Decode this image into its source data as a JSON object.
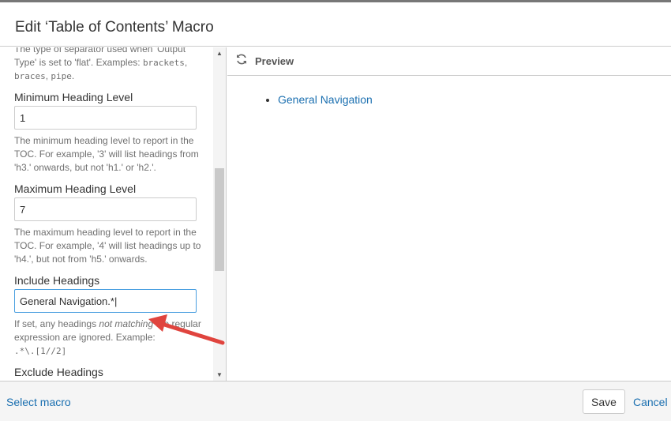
{
  "dialog": {
    "title": "Edit ‘Table of Contents’ Macro"
  },
  "form": {
    "separator_desc": "The type of separator used when 'Output Type' is set to 'flat'. Examples: ",
    "separator_ex1": "brackets",
    "separator_ex2": "braces",
    "separator_ex3": "pipe",
    "min_label": "Minimum Heading Level",
    "min_value": "1",
    "min_desc": "The minimum heading level to report in the TOC. For example, '3' will list headings from 'h3.' onwards, but not 'h1.' or 'h2.'.",
    "max_label": "Maximum Heading Level",
    "max_value": "7",
    "max_desc": "The maximum heading level to report in the TOC. For example, '4' will list headings up to 'h4.', but not from 'h5.' onwards.",
    "include_label": "Include Headings",
    "include_value": "General Navigation.*",
    "include_desc_1": "If set, any headings ",
    "include_desc_em": "not matching",
    "include_desc_2": " the regular expression are ignored. Example: ",
    "include_example": ".*\\.[1//2]",
    "exclude_label": "Exclude Headings"
  },
  "preview": {
    "title": "Preview",
    "items": [
      "General Navigation"
    ]
  },
  "footer": {
    "select_macro": "Select macro",
    "save": "Save",
    "cancel": "Cancel"
  }
}
